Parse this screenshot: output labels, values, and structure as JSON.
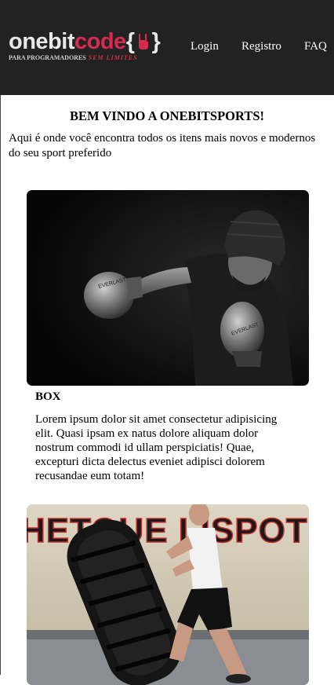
{
  "brand": {
    "name_part1": "onebit",
    "name_part2": "code",
    "braces": "{}",
    "tagline_part1": "PARA PROGRAMADORES",
    "tagline_part2": "SEM LIMITES"
  },
  "nav": {
    "items": [
      {
        "label": "Login"
      },
      {
        "label": "Registro"
      },
      {
        "label": "FAQ"
      }
    ]
  },
  "welcome": {
    "title": "BEM VINDO A ONEBITSPORTS!",
    "text": "Aqui é onde você encontra todos os itens mais novos e modernos do seu sport preferido"
  },
  "cards": [
    {
      "title": "BOX",
      "text": "Lorem ipsum dolor sit amet consectetur adipisicing elit. Quasi ipsam ex natus dolore aliquam dolor nostrum commodi id ullam perspiciatis! Quae, excepturi dicta delectus eveniet adipisci dolorem recusandae eum totam!"
    },
    {
      "title": "",
      "text": "",
      "image_wall_text": "HETOUE LISPOT"
    }
  ],
  "colors": {
    "navbar_bg": "#222222",
    "brand_accent": "#d62b4e",
    "page_bg": "#ffffff"
  }
}
